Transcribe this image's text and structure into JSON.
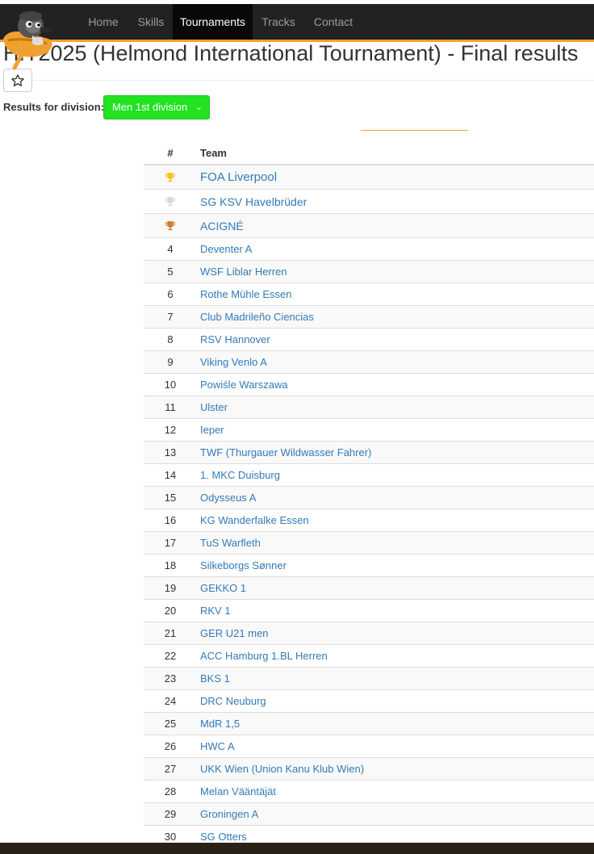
{
  "nav": {
    "items": [
      {
        "label": "Home",
        "active": false
      },
      {
        "label": "Skills",
        "active": false
      },
      {
        "label": "Tournaments",
        "active": true
      },
      {
        "label": "Tracks",
        "active": false
      },
      {
        "label": "Contact",
        "active": false
      }
    ]
  },
  "page": {
    "title": "HIT2025 (Helmond International Tournament) - Final results",
    "favorite_icon": "star-outline-icon"
  },
  "division": {
    "label": "Results for division:",
    "selected": "Men 1st division"
  },
  "table": {
    "headers": {
      "rank": "#",
      "team": "Team"
    },
    "rows": [
      {
        "rank": "",
        "team": "FOA Liverpool",
        "trophy": "gold"
      },
      {
        "rank": "",
        "team": "SG KSV Havelbrüder",
        "trophy": "silver"
      },
      {
        "rank": "",
        "team": "ACIGNÉ",
        "trophy": "bronze"
      },
      {
        "rank": "4",
        "team": "Deventer A"
      },
      {
        "rank": "5",
        "team": "WSF Liblar Herren"
      },
      {
        "rank": "6",
        "team": "Rothe Mühle Essen"
      },
      {
        "rank": "7",
        "team": "Club Madrileño Ciencias"
      },
      {
        "rank": "8",
        "team": "RSV Hannover"
      },
      {
        "rank": "9",
        "team": "Viking Venlo A"
      },
      {
        "rank": "10",
        "team": "Powiśle Warszawa"
      },
      {
        "rank": "11",
        "team": "Ulster"
      },
      {
        "rank": "12",
        "team": "Ieper"
      },
      {
        "rank": "13",
        "team": "TWF (Thurgauer Wildwasser Fahrer)"
      },
      {
        "rank": "14",
        "team": "1. MKC Duisburg"
      },
      {
        "rank": "15",
        "team": "Odysseus A"
      },
      {
        "rank": "16",
        "team": "KG Wanderfalke Essen"
      },
      {
        "rank": "17",
        "team": "TuS Warfleth"
      },
      {
        "rank": "18",
        "team": "Silkeborgs Sønner"
      },
      {
        "rank": "19",
        "team": "GEKKO 1"
      },
      {
        "rank": "20",
        "team": "RKV 1"
      },
      {
        "rank": "21",
        "team": "GER U21 men"
      },
      {
        "rank": "22",
        "team": "ACC Hamburg 1.BL Herren"
      },
      {
        "rank": "23",
        "team": "BKS 1"
      },
      {
        "rank": "24",
        "team": "DRC Neuburg"
      },
      {
        "rank": "25",
        "team": "MdR 1,5"
      },
      {
        "rank": "26",
        "team": "HWC A"
      },
      {
        "rank": "27",
        "team": "UKK Wien (Union Kanu Klub Wien)"
      },
      {
        "rank": "28",
        "team": "Melan Vääntäjät"
      },
      {
        "rank": "29",
        "team": "Groningen A"
      },
      {
        "rank": "30",
        "team": "SG Otters"
      }
    ]
  },
  "colors": {
    "navbar": "#222222",
    "accent": "#f0a030",
    "division_select": "#22e222",
    "link": "#337ab7",
    "gold": "#f5c518",
    "silver": "#d9d9d9",
    "bronze": "#cd7f32"
  }
}
